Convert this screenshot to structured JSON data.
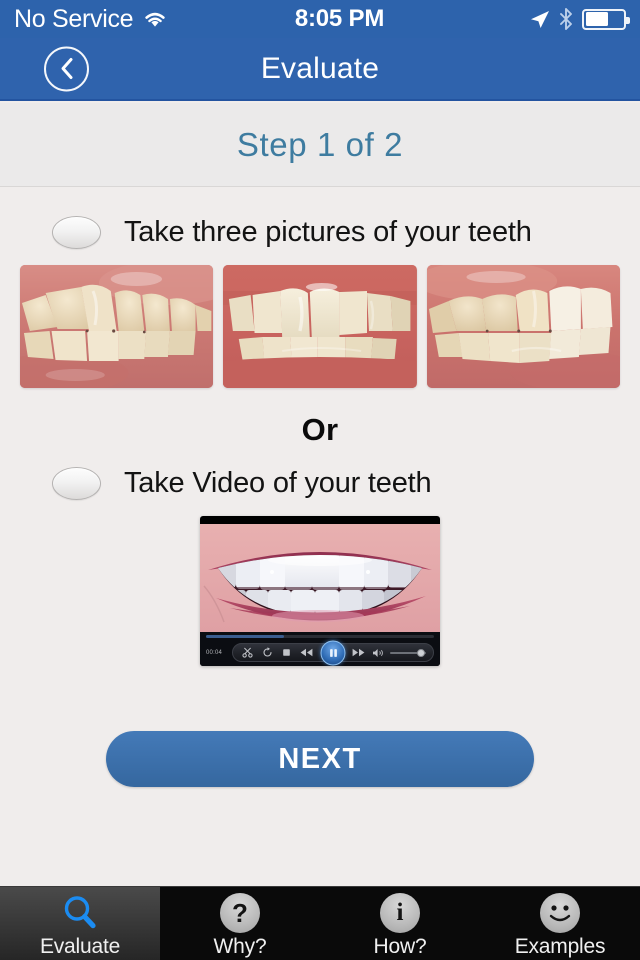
{
  "status_bar": {
    "carrier": "No Service",
    "wifi_icon": "wifi-icon",
    "time": "8:05 PM",
    "location_icon": "location-arrow-icon",
    "bluetooth_icon": "bluetooth-icon",
    "battery_icon": "battery-icon",
    "battery_percent": 55
  },
  "nav_bar": {
    "back_icon": "chevron-left-icon",
    "title": "Evaluate",
    "background_color": "#2f63ad"
  },
  "step_header": {
    "text": "Step 1 of 2",
    "color": "#3e7ca0"
  },
  "main": {
    "photo_option": {
      "label": "Take three pictures of your teeth",
      "selected": false,
      "photos": [
        {
          "name": "teeth-left-buccal-photo",
          "alt": "Left side view of teeth and gums"
        },
        {
          "name": "teeth-front-photo",
          "alt": "Front view of upper and lower teeth"
        },
        {
          "name": "teeth-right-buccal-photo",
          "alt": "Right side view of teeth and gums"
        }
      ]
    },
    "divider_text": "Or",
    "video_option": {
      "label": "Take Video of your teeth",
      "selected": false,
      "video": {
        "name": "smile-video-thumbnail",
        "alt": "Close-up video of a smile showing white teeth",
        "current_time": "00:04",
        "progress_percent": 34,
        "state": "playing",
        "controls": [
          {
            "name": "trim-icon",
            "label": "Trim"
          },
          {
            "name": "loop-icon",
            "label": "Loop"
          },
          {
            "name": "stop-icon",
            "label": "Stop"
          },
          {
            "name": "rewind-icon",
            "label": "Rewind"
          },
          {
            "name": "pause-icon",
            "label": "Pause"
          },
          {
            "name": "fast-forward-icon",
            "label": "Fast forward"
          },
          {
            "name": "volume-icon",
            "label": "Volume"
          }
        ],
        "volume_percent": 95
      }
    },
    "next_button": {
      "label": "NEXT",
      "color": "#3b6ea8"
    }
  },
  "tab_bar": {
    "tabs": [
      {
        "label": "Evaluate",
        "icon": "magnifier-icon",
        "active": true
      },
      {
        "label": "Why?",
        "icon": "question-mark-circle-icon",
        "active": false
      },
      {
        "label": "How?",
        "icon": "info-circle-icon",
        "active": false
      },
      {
        "label": "Examples",
        "icon": "smiley-face-icon",
        "active": false
      }
    ]
  }
}
